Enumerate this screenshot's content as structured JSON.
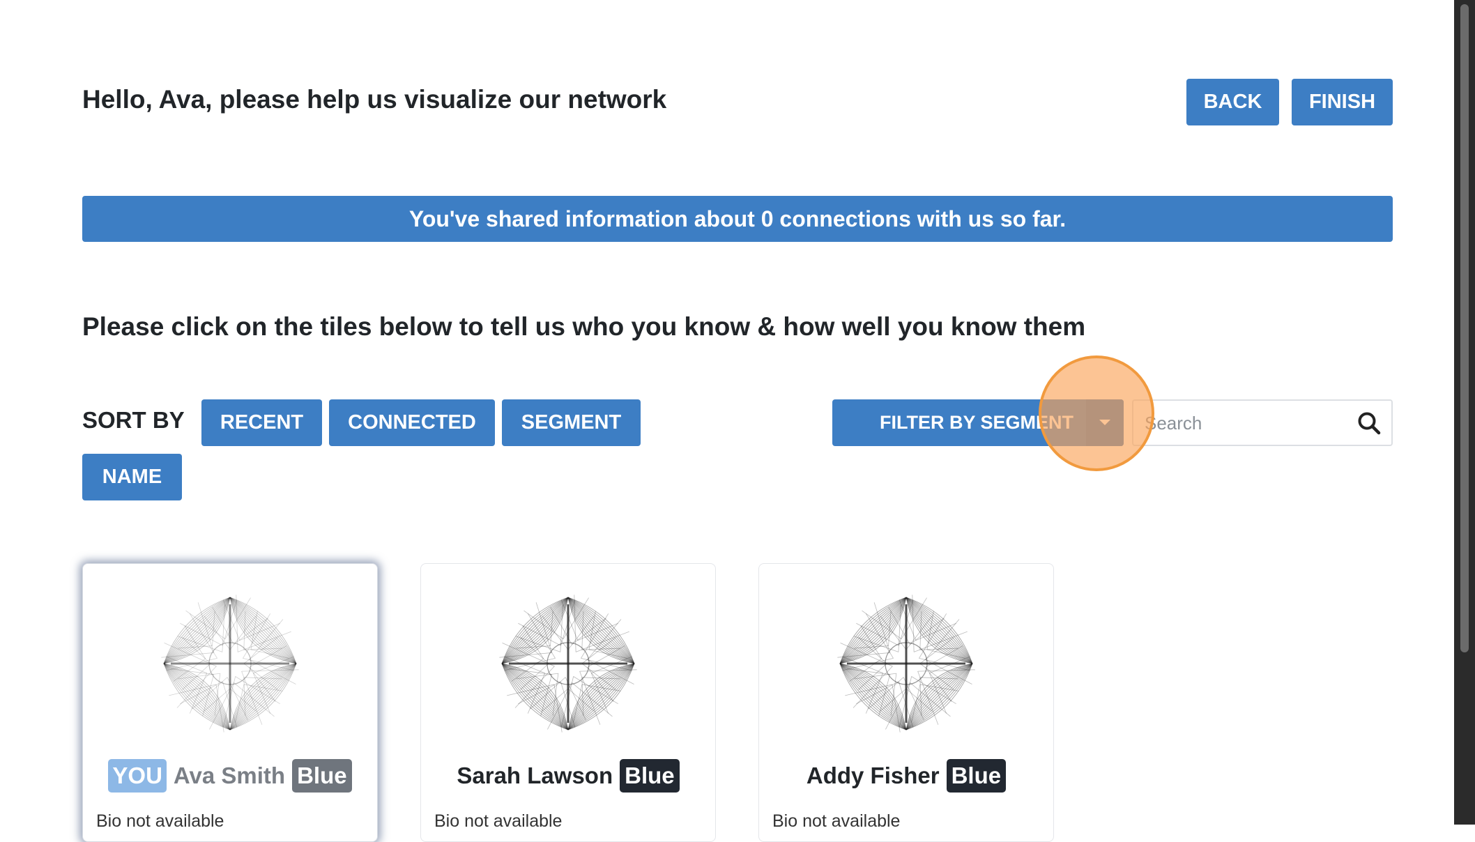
{
  "header": {
    "greeting": "Hello, Ava, please help us visualize our network",
    "back_label": "BACK",
    "finish_label": "FINISH"
  },
  "banner": {
    "text": "You've shared information about 0 connections with us so far."
  },
  "instructions": "Please click on the tiles below to tell us who you know & how well you know them",
  "sort": {
    "label": "SORT BY",
    "options": [
      "RECENT",
      "CONNECTED",
      "SEGMENT",
      "NAME"
    ]
  },
  "filter": {
    "label": "FILTER BY SEGMENT"
  },
  "search": {
    "placeholder": "Search",
    "value": ""
  },
  "cards": [
    {
      "you_badge": "YOU",
      "name": "Ava Smith",
      "segment": "Blue",
      "bio": "Bio not available",
      "is_self": true
    },
    {
      "name": "Sarah Lawson",
      "segment": "Blue",
      "bio": "Bio not available",
      "is_self": false
    },
    {
      "name": "Addy Fisher",
      "segment": "Blue",
      "bio": "Bio not available",
      "is_self": false
    }
  ],
  "colors": {
    "accent": "#3d7ec4",
    "badge_dark": "#222831",
    "badge_grey": "#6f757d",
    "you_badge": "#8db8e6",
    "cursor_highlight": "#f19a3e"
  },
  "icons": {
    "search": "search-icon",
    "dropdown": "caret-down-icon",
    "avatar": "mandala-avatar-icon"
  }
}
